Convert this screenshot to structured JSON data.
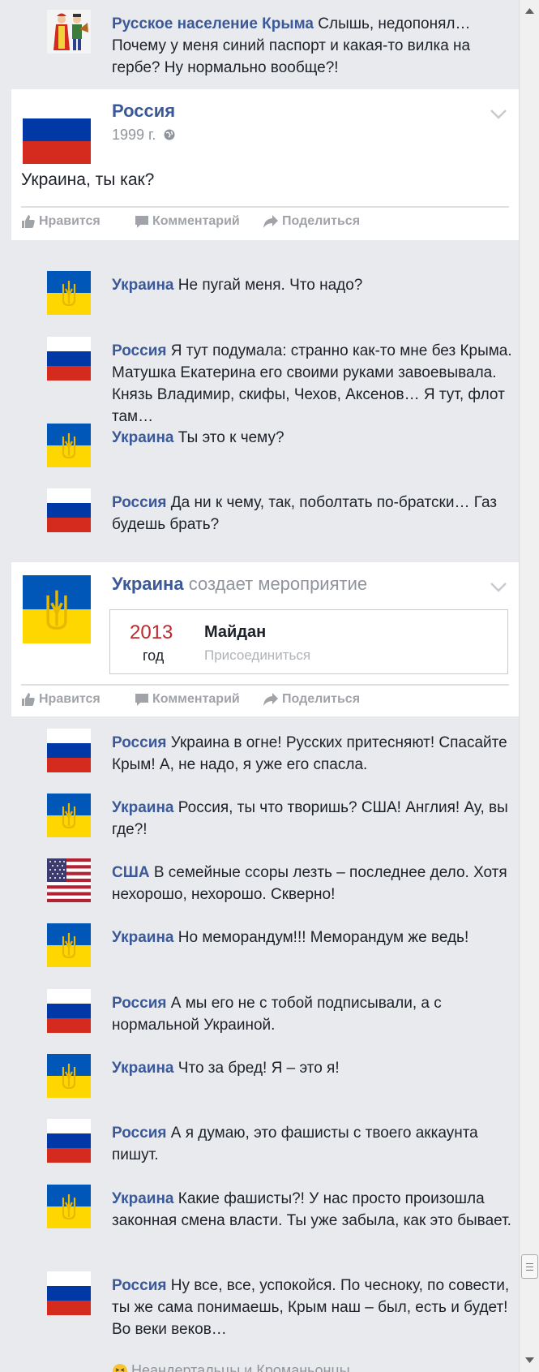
{
  "icons": {
    "like": "thumbs-up-icon",
    "comment": "speech-bubble-icon",
    "share": "share-arrow-icon",
    "globe": "globe-icon",
    "chevron": "chevron-down-icon",
    "laugh": "laughing-emoji-icon"
  },
  "colors": {
    "link": "#3b5998",
    "muted": "#90949c",
    "event_year": "#c1272d",
    "russia_flag": [
      "#ffffff",
      "#0039a6",
      "#d52b1e"
    ],
    "ukraine_flag": [
      "#0057b7",
      "#ffd700"
    ]
  },
  "action_labels": {
    "like": "Нравится",
    "comment": "Комментарий",
    "share": "Поделиться"
  },
  "top_comment": {
    "name": "Русское население Крыма",
    "text": "Слышь, недопонял… Почему у меня синий паспорт и какая-то вилка на гербе? Ну нормально вообще?!"
  },
  "post1": {
    "author": "Россия",
    "date": "1999 г.",
    "body": "Украина, ты как?"
  },
  "thread1": [
    {
      "name": "Украина",
      "text": "Не пугай меня. Что надо?"
    },
    {
      "name": "Россия",
      "text": "Я тут подумала: странно как-то мне без Крыма. Матушка Екатерина его своими руками завоевывала. Князь Владимир, скифы, Чехов, Аксенов… Я тут, флот там…"
    },
    {
      "name": "Украина",
      "text": "Ты это к чему?"
    },
    {
      "name": "Россия",
      "text": "Да ни к чему, так, поболтать по-братски… Газ будешь брать?"
    }
  ],
  "post2": {
    "author": "Украина",
    "verb": "создает мероприятие",
    "event": {
      "year": "2013",
      "unit": "год",
      "title": "Майдан",
      "join": "Присоединиться"
    }
  },
  "thread2": [
    {
      "name": "Россия",
      "text": "Украина в огне! Русских притесняют! Спасайте Крым! А, не надо, я уже его спасла."
    },
    {
      "name": "Украина",
      "text": "Россия, ты что творишь? США! Англия! Ау, вы где?!"
    },
    {
      "name": "США",
      "text": "В семейные ссоры лезть – последнее дело. Хотя нехорошо, нехорошо. Скверно!"
    },
    {
      "name": "Украина",
      "text": "Но меморандум!!! Меморандум же ведь!"
    },
    {
      "name": "Россия",
      "text": "А мы его не с тобой подписывали, а с нормальной Украиной."
    },
    {
      "name": "Украина",
      "text": "Что за бред! Я – это я!"
    },
    {
      "name": "Россия",
      "text": "А я думаю, это фашисты с твоего аккаунта пишут."
    },
    {
      "name": "Украина",
      "text": "Какие фашисты?! У нас просто произошла законная смена власти. Ты уже забыла, как это бывает."
    },
    {
      "name": "Россия",
      "text": "Ну все, все, успокойся. По чесноку, по совести, ты же сама понимаешь, Крым наш – был, есть и будет! Во веки веков…"
    }
  ],
  "reaction": "Неандертальцы и Кроманьонцы"
}
